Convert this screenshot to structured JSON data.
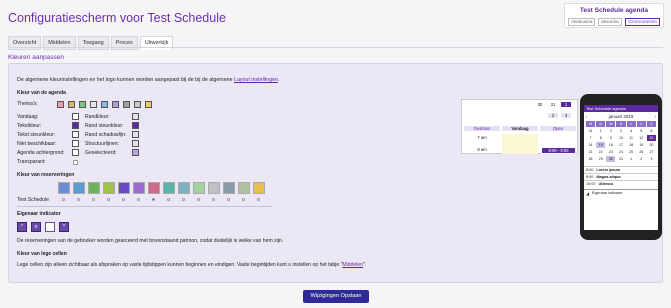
{
  "page_title": "Configuratiescherm voor Test Schedule",
  "agenda": {
    "title": "Test Schedule agenda",
    "buttons": [
      "GEBRUIKEN",
      "BEKIJKEN",
      "CONFIGUREREN"
    ]
  },
  "tabs": [
    "Overzicht",
    "Middelen",
    "Toegang",
    "Proces",
    "Uitwerkijk"
  ],
  "section": "Kleuren aanpassen",
  "intro": {
    "text": "De algemene kleurinstellingen en het logo kunnen worden aangepast bij de bij de algemene ",
    "link": "Layout instellingen",
    "end": "."
  },
  "agenda_colors": {
    "heading": "Kleur van de agenda",
    "themes_label": "Thema's:",
    "theme_colors": [
      "#e7a0a8",
      "#d9b46a",
      "#7fc47f",
      "#e6e6ea",
      "#8fb5e8",
      "#b59ae0",
      "#9e9e9e",
      "#c9c9c9",
      "#f0c96a"
    ],
    "left": [
      {
        "label": "Vandaag:",
        "color": "#ffffff"
      },
      {
        "label": "Tekstkleur:",
        "color": "#5b2aa0"
      },
      {
        "label": "Tekst steunkleur:",
        "color": "#ffffff"
      },
      {
        "label": "Niet beschikbaar:",
        "color": "#ffffff"
      },
      {
        "label": "Agenda achtergrond:",
        "color": "#ffffff"
      },
      {
        "label": "Transparant:",
        "color": ""
      }
    ],
    "right": [
      {
        "label": "Randkleur:",
        "color": "#e6e0f2"
      },
      {
        "label": "Rand steunkleur:",
        "color": "#5b2aa0"
      },
      {
        "label": "Rand schaduwlijn:",
        "color": "#e6e0f2"
      },
      {
        "label": "Structuurlijnen:",
        "color": "#e6e0f2"
      },
      {
        "label": "Geselecteerd:",
        "color": "#b8a6e0"
      }
    ]
  },
  "reservation": {
    "heading": "Kleur van reserveringen",
    "colors": [
      "#6a8fd8",
      "#5a9bd0",
      "#6eb25a",
      "#9fc24a",
      "#6a4ac0",
      "#9b6ad0",
      "#d06a8a",
      "#5ab5a8",
      "#7ab0c0",
      "#a5d0a0",
      "#c0c0c8",
      "#8a9aa8",
      "#b0c0a0",
      "#e8c050"
    ],
    "row_label": "Test Schedule",
    "selected_index": 6
  },
  "owner": {
    "heading": "Eigenaar indicator",
    "icons": [
      "*",
      "o",
      "",
      "*"
    ],
    "selected": 2,
    "note": "De reserveringen van de gebruiker worden gearceerd met bovenstaand patroon, zodat duidelijk is welke van hem zijn."
  },
  "empty": {
    "heading": "Kleur van lege cellen",
    "text": "Lege cellen zijn alleen zichtbaar als afspraken op vaste tijdstippen kunnen beginnen en eindigen. Vaste begintijden kunt u instellen op het tabje \"",
    "link": "Middelen",
    "end": "\"."
  },
  "preview": {
    "day_nums": [
      "30",
      "31",
      "1"
    ],
    "day_nums2": [
      "2",
      "3"
    ],
    "cols": [
      "Gesloten",
      "Vandaag",
      "Open"
    ],
    "times": [
      "7 am",
      "8 am"
    ],
    "event": "8:00 - 9:00"
  },
  "phone": {
    "app": "Test Schedule agenda",
    "month": "januari 2019",
    "days": [
      "M",
      "D",
      "W",
      "D",
      "V",
      "Z",
      "Z"
    ],
    "dates": [
      "31",
      "1",
      "2",
      "3",
      "4",
      "5",
      "6",
      "7",
      "8",
      "9",
      "10",
      "11",
      "12",
      "13",
      "14",
      "15",
      "16",
      "17",
      "18",
      "19",
      "20",
      "21",
      "22",
      "23",
      "24",
      "25",
      "26",
      "27",
      "28",
      "29",
      "30",
      "31",
      "1",
      "2",
      "3"
    ],
    "events": [
      {
        "time": "8:00",
        "title": "Lorem ipsum"
      },
      {
        "time": "9:00",
        "title": "Magna aliqua"
      },
      {
        "time": "10:00",
        "title": "Ullamco"
      }
    ],
    "footer": "Eigenaar indicator"
  },
  "save": "Wijzigingen Opslaan"
}
